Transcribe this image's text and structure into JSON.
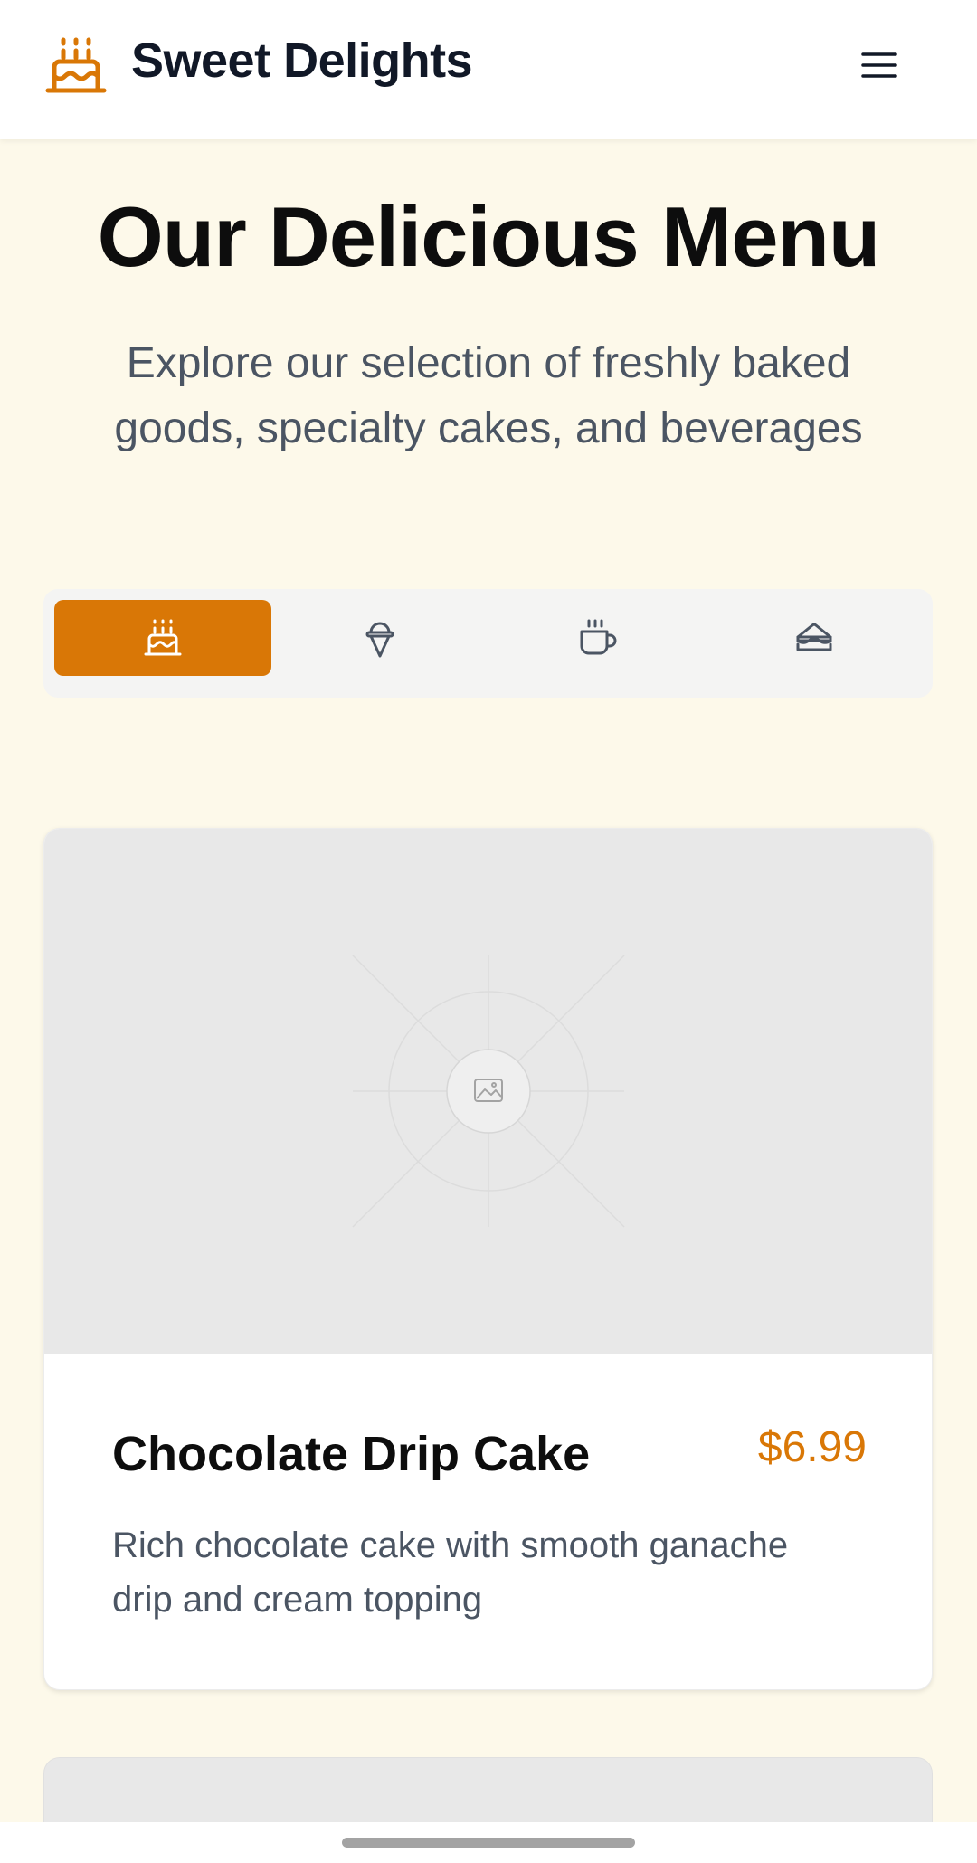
{
  "header": {
    "brand_name": "Sweet Delights",
    "brand_icon": "cake-icon",
    "menu_icon": "hamburger-menu-icon"
  },
  "hero": {
    "title": "Our Delicious Menu",
    "subtitle": "Explore our selection of freshly baked goods, specialty cakes, and beverages"
  },
  "tabs": [
    {
      "icon": "cake-icon",
      "active": true
    },
    {
      "icon": "ice-cream-icon",
      "active": false
    },
    {
      "icon": "coffee-cup-icon",
      "active": false
    },
    {
      "icon": "sandwich-icon",
      "active": false
    }
  ],
  "menu_items": [
    {
      "name": "Chocolate Drip Cake",
      "price": "$6.99",
      "description": "Rich chocolate cake with smooth ganache drip and cream topping",
      "image_icon": "image-placeholder-icon"
    }
  ],
  "colors": {
    "accent": "#d97706",
    "background": "#fdf9ea",
    "text": "#111827",
    "muted_text": "#4b5563"
  }
}
